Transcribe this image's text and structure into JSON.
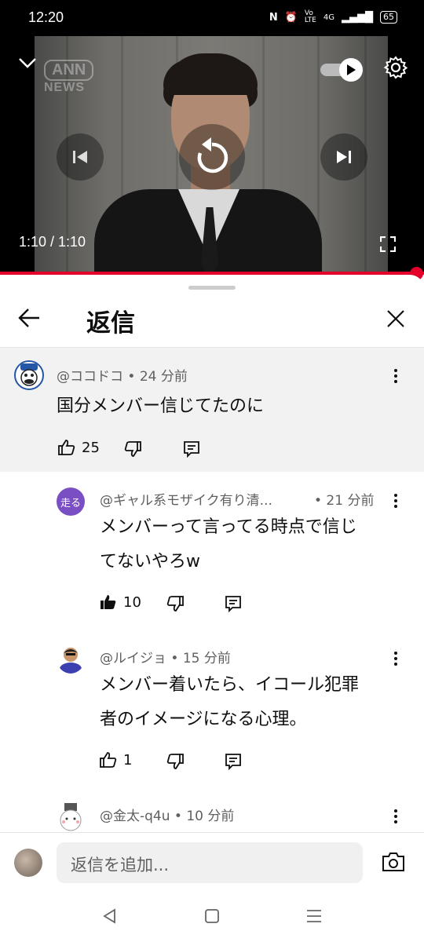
{
  "status_bar": {
    "time": "12:20",
    "battery": "65",
    "network": "4G"
  },
  "video": {
    "watermark_top": "ANN",
    "watermark_bottom": "NEWS",
    "time_display": "1:10 / 1:10",
    "progress": 1.0
  },
  "panel": {
    "title": "返信"
  },
  "comments": [
    {
      "author": "@ココドコ • 24 分前",
      "text": "国分メンバー信じてたのに",
      "likes": "25",
      "liked": false
    },
    {
      "author": "@ギャル系モザイク有り清...",
      "time": "• 21 分前",
      "avatar_text": "走る",
      "text_line1": "メンバーって言ってる時点で信じ",
      "text_line2": "てないやろw",
      "likes": "10",
      "liked": true
    },
    {
      "author": "@ルイジョ • 15 分前",
      "text_line1": "メンバー着いたら、イコール犯罪",
      "text_line2": "者のイメージになる心理。",
      "likes": "1",
      "liked": false
    },
    {
      "author": "@金太-q4u • 10 分前"
    }
  ],
  "reply_bar": {
    "placeholder": "返信を追加..."
  },
  "colors": {
    "accent_red": "#e4002b",
    "avatar_purple": "#7b4fc4"
  }
}
